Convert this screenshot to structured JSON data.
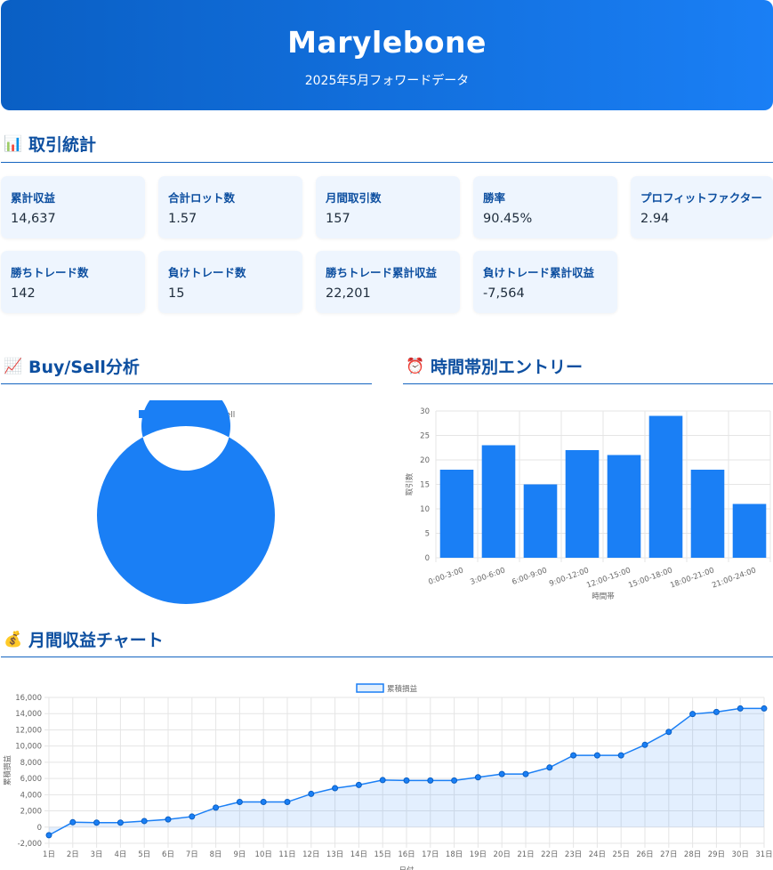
{
  "header": {
    "title": "Marylebone",
    "subtitle": "2025年5月フォワードデータ"
  },
  "sections": {
    "stats": {
      "icon": "bar-chart-emoji-icon",
      "title": "取引統計"
    },
    "buysell": {
      "icon": "trend-up-emoji-icon",
      "title": "Buy/Sell分析"
    },
    "hourly": {
      "icon": "alarm-clock-emoji-icon",
      "title": "時間帯別エントリー"
    },
    "monthly": {
      "icon": "money-bag-emoji-icon",
      "title": "月間収益チャート"
    }
  },
  "stats": [
    {
      "label": "累計収益",
      "value": "14,637"
    },
    {
      "label": "合計ロット数",
      "value": "1.57"
    },
    {
      "label": "月間取引数",
      "value": "157"
    },
    {
      "label": "勝率",
      "value": "90.45%"
    },
    {
      "label": "プロフィットファクター",
      "value": "2.94"
    },
    {
      "label": "勝ちトレード数",
      "value": "142"
    },
    {
      "label": "負けトレード数",
      "value": "15"
    },
    {
      "label": "勝ちトレード累計収益",
      "value": "22,201"
    },
    {
      "label": "負けトレード累計収益",
      "value": "-7,564"
    }
  ],
  "colors": {
    "primary": "#1a7ff5",
    "sell": "#dc3545",
    "title": "#0d4fa0",
    "card_bg": "#eef5fe"
  },
  "chart_data": [
    {
      "type": "pie",
      "variant": "doughnut",
      "legend": "top",
      "labels": [
        "Buy",
        "Sell"
      ],
      "values": [
        157,
        0
      ],
      "colors": [
        "#1a7ff5",
        "#dc3545"
      ]
    },
    {
      "type": "bar",
      "categories": [
        "0:00-3:00",
        "3:00-6:00",
        "6:00-9:00",
        "9:00-12:00",
        "12:00-15:00",
        "15:00-18:00",
        "18:00-21:00",
        "21:00-24:00"
      ],
      "values": [
        18,
        23,
        15,
        22,
        21,
        29,
        18,
        11
      ],
      "xlabel": "時間帯",
      "ylabel": "取引数",
      "ylim": [
        0,
        30
      ],
      "yticks": [
        0,
        5,
        10,
        15,
        20,
        25,
        30
      ],
      "grid": true
    },
    {
      "type": "area",
      "legend": "top",
      "series": [
        {
          "name": "累積損益",
          "values": [
            -1000,
            600,
            550,
            550,
            750,
            950,
            1300,
            2400,
            3100,
            3100,
            3100,
            4100,
            4800,
            5200,
            5800,
            5750,
            5750,
            5750,
            6150,
            6550,
            6550,
            7350,
            8850,
            8850,
            8850,
            10150,
            11750,
            13950,
            14200,
            14637,
            14637
          ]
        }
      ],
      "categories": [
        "1日",
        "2日",
        "3日",
        "4日",
        "5日",
        "6日",
        "7日",
        "8日",
        "9日",
        "10日",
        "11日",
        "12日",
        "13日",
        "14日",
        "15日",
        "16日",
        "17日",
        "18日",
        "19日",
        "20日",
        "21日",
        "22日",
        "23日",
        "24日",
        "25日",
        "26日",
        "27日",
        "28日",
        "29日",
        "30日",
        "31日"
      ],
      "xlabel": "日付",
      "ylabel": "累積損益",
      "ylim": [
        -2000,
        16000
      ],
      "yticks": [
        "-2,000",
        "0",
        "2,000",
        "4,000",
        "6,000",
        "8,000",
        "10,000",
        "12,000",
        "14,000",
        "16,000"
      ],
      "grid": true
    }
  ]
}
